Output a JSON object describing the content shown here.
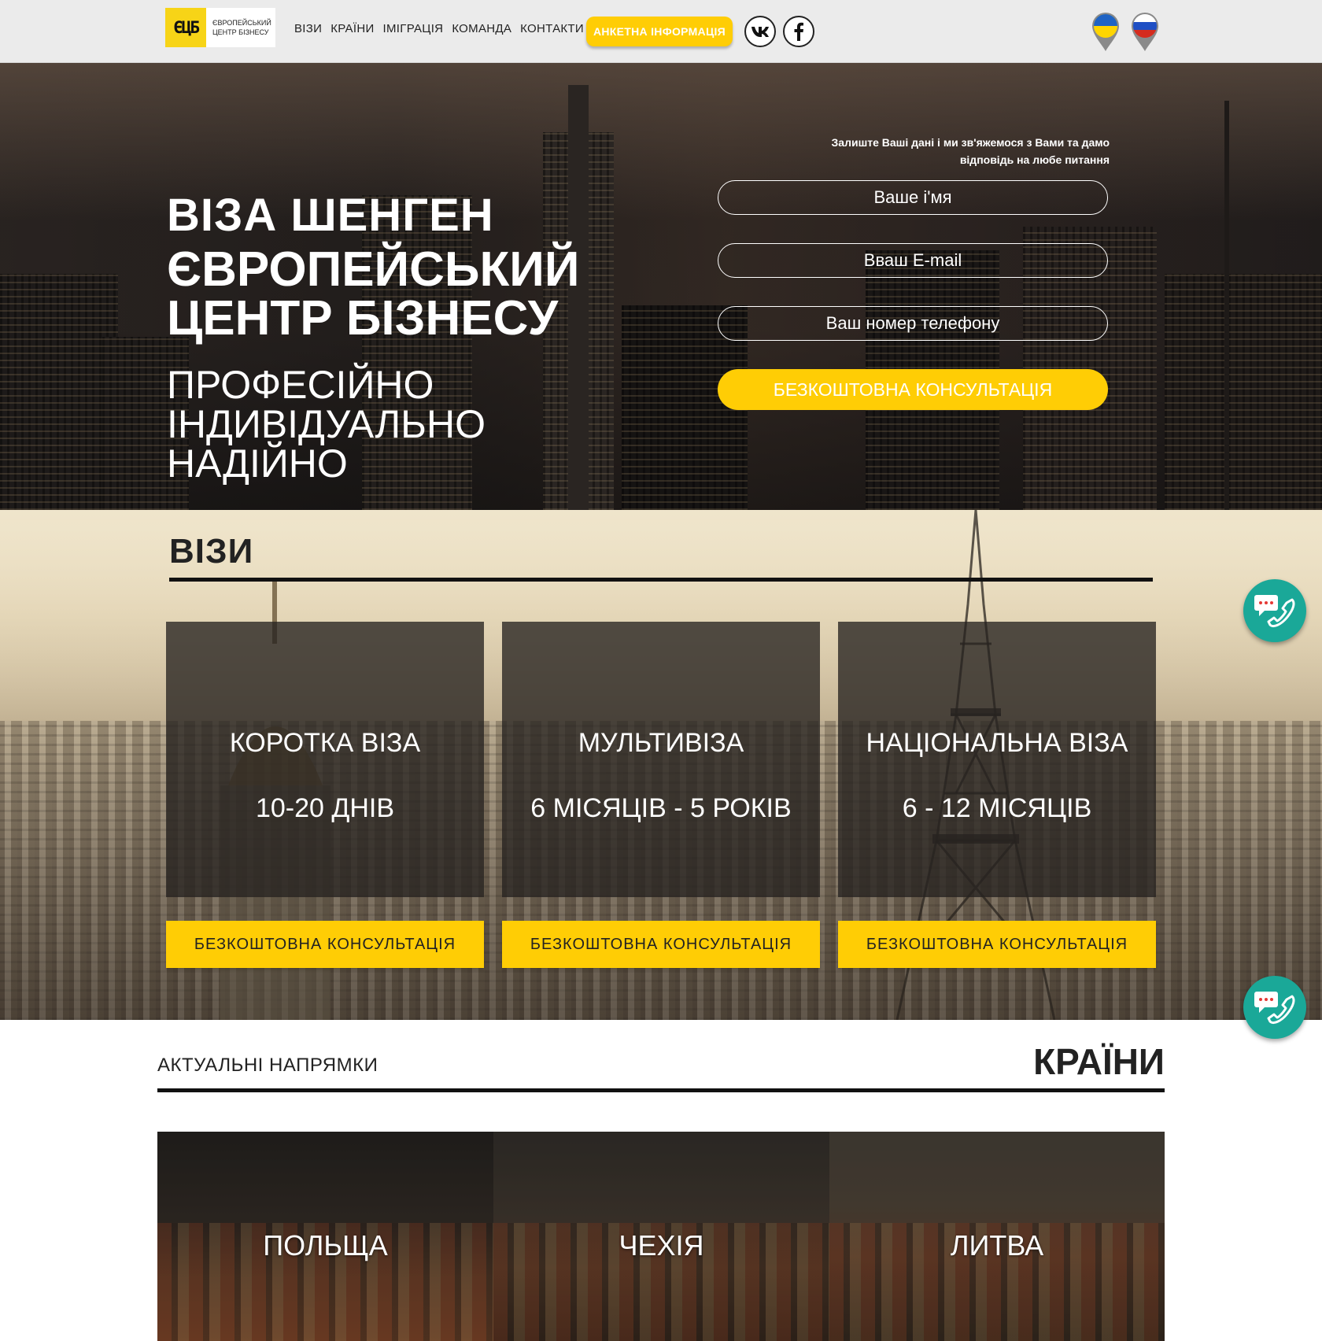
{
  "header": {
    "logo_mark": "ЄЦБ",
    "logo_line1": "Європейський",
    "logo_line2": "центр бізнесу",
    "nav": [
      "ВІЗИ",
      "КРАЇНИ",
      "ІМІГРАЦІЯ",
      "КОМАНДА",
      "КОНТАКТИ"
    ],
    "anketa_label": "АНКЕТНА ІНФОРМАЦІЯ",
    "social": [
      "vk-icon",
      "facebook-icon"
    ],
    "languages": [
      "ukraine-flag-icon",
      "russia-flag-icon"
    ]
  },
  "hero": {
    "title_1": "ВІЗА ШЕНГЕН",
    "title_2_line1": "ЄВРОПЕЙСЬКИЙ",
    "title_2_line2": "ЦЕНТР БІЗНЕСУ",
    "sub_1": "ПРОФЕСІЙНО",
    "sub_2": "ІНДИВІДУАЛЬНО",
    "sub_3": "НАДІЙНО",
    "form_note_1": "Залиште Ваші дані і ми зв'яжемося з Вами та дамо",
    "form_note_2": "відповідь на любе питання",
    "name_placeholder": "Ваше і'мя",
    "email_placeholder": "Вваш E-mail",
    "phone_placeholder": "Ваш номер телефону",
    "submit_label": "БЕЗКОШТОВНА КОНСУЛЬТАЦІЯ"
  },
  "visas": {
    "heading": "ВІЗИ",
    "cards": [
      {
        "name": "КОРОТКА ВІЗА",
        "term": "10-20 ДНІВ",
        "button": "БЕЗКОШТОВНА КОНСУЛЬТАЦІЯ"
      },
      {
        "name": "МУЛЬТИВІЗА",
        "term": "6 МІСЯЦІВ - 5 РОКІВ",
        "button": "БЕЗКОШТОВНА КОНСУЛЬТАЦІЯ"
      },
      {
        "name": "НАЦІОНАЛЬНА ВІЗА",
        "term": "6 - 12 МІСЯЦІВ",
        "button": "БЕЗКОШТОВНА КОНСУЛЬТАЦІЯ"
      }
    ]
  },
  "countries": {
    "subtitle": "АКТУАЛЬНІ НАПРЯМКИ",
    "title": "КРАЇНИ",
    "items": [
      "ПОЛЬЩА",
      "ЧЕХІЯ",
      "ЛИТВА"
    ]
  },
  "colors": {
    "accent_yellow": "#ffcd05",
    "chat_teal": "#1aa898",
    "header_bg": "#ebebeb"
  },
  "floating": [
    "chat-call-icon",
    "chat-call-icon"
  ]
}
